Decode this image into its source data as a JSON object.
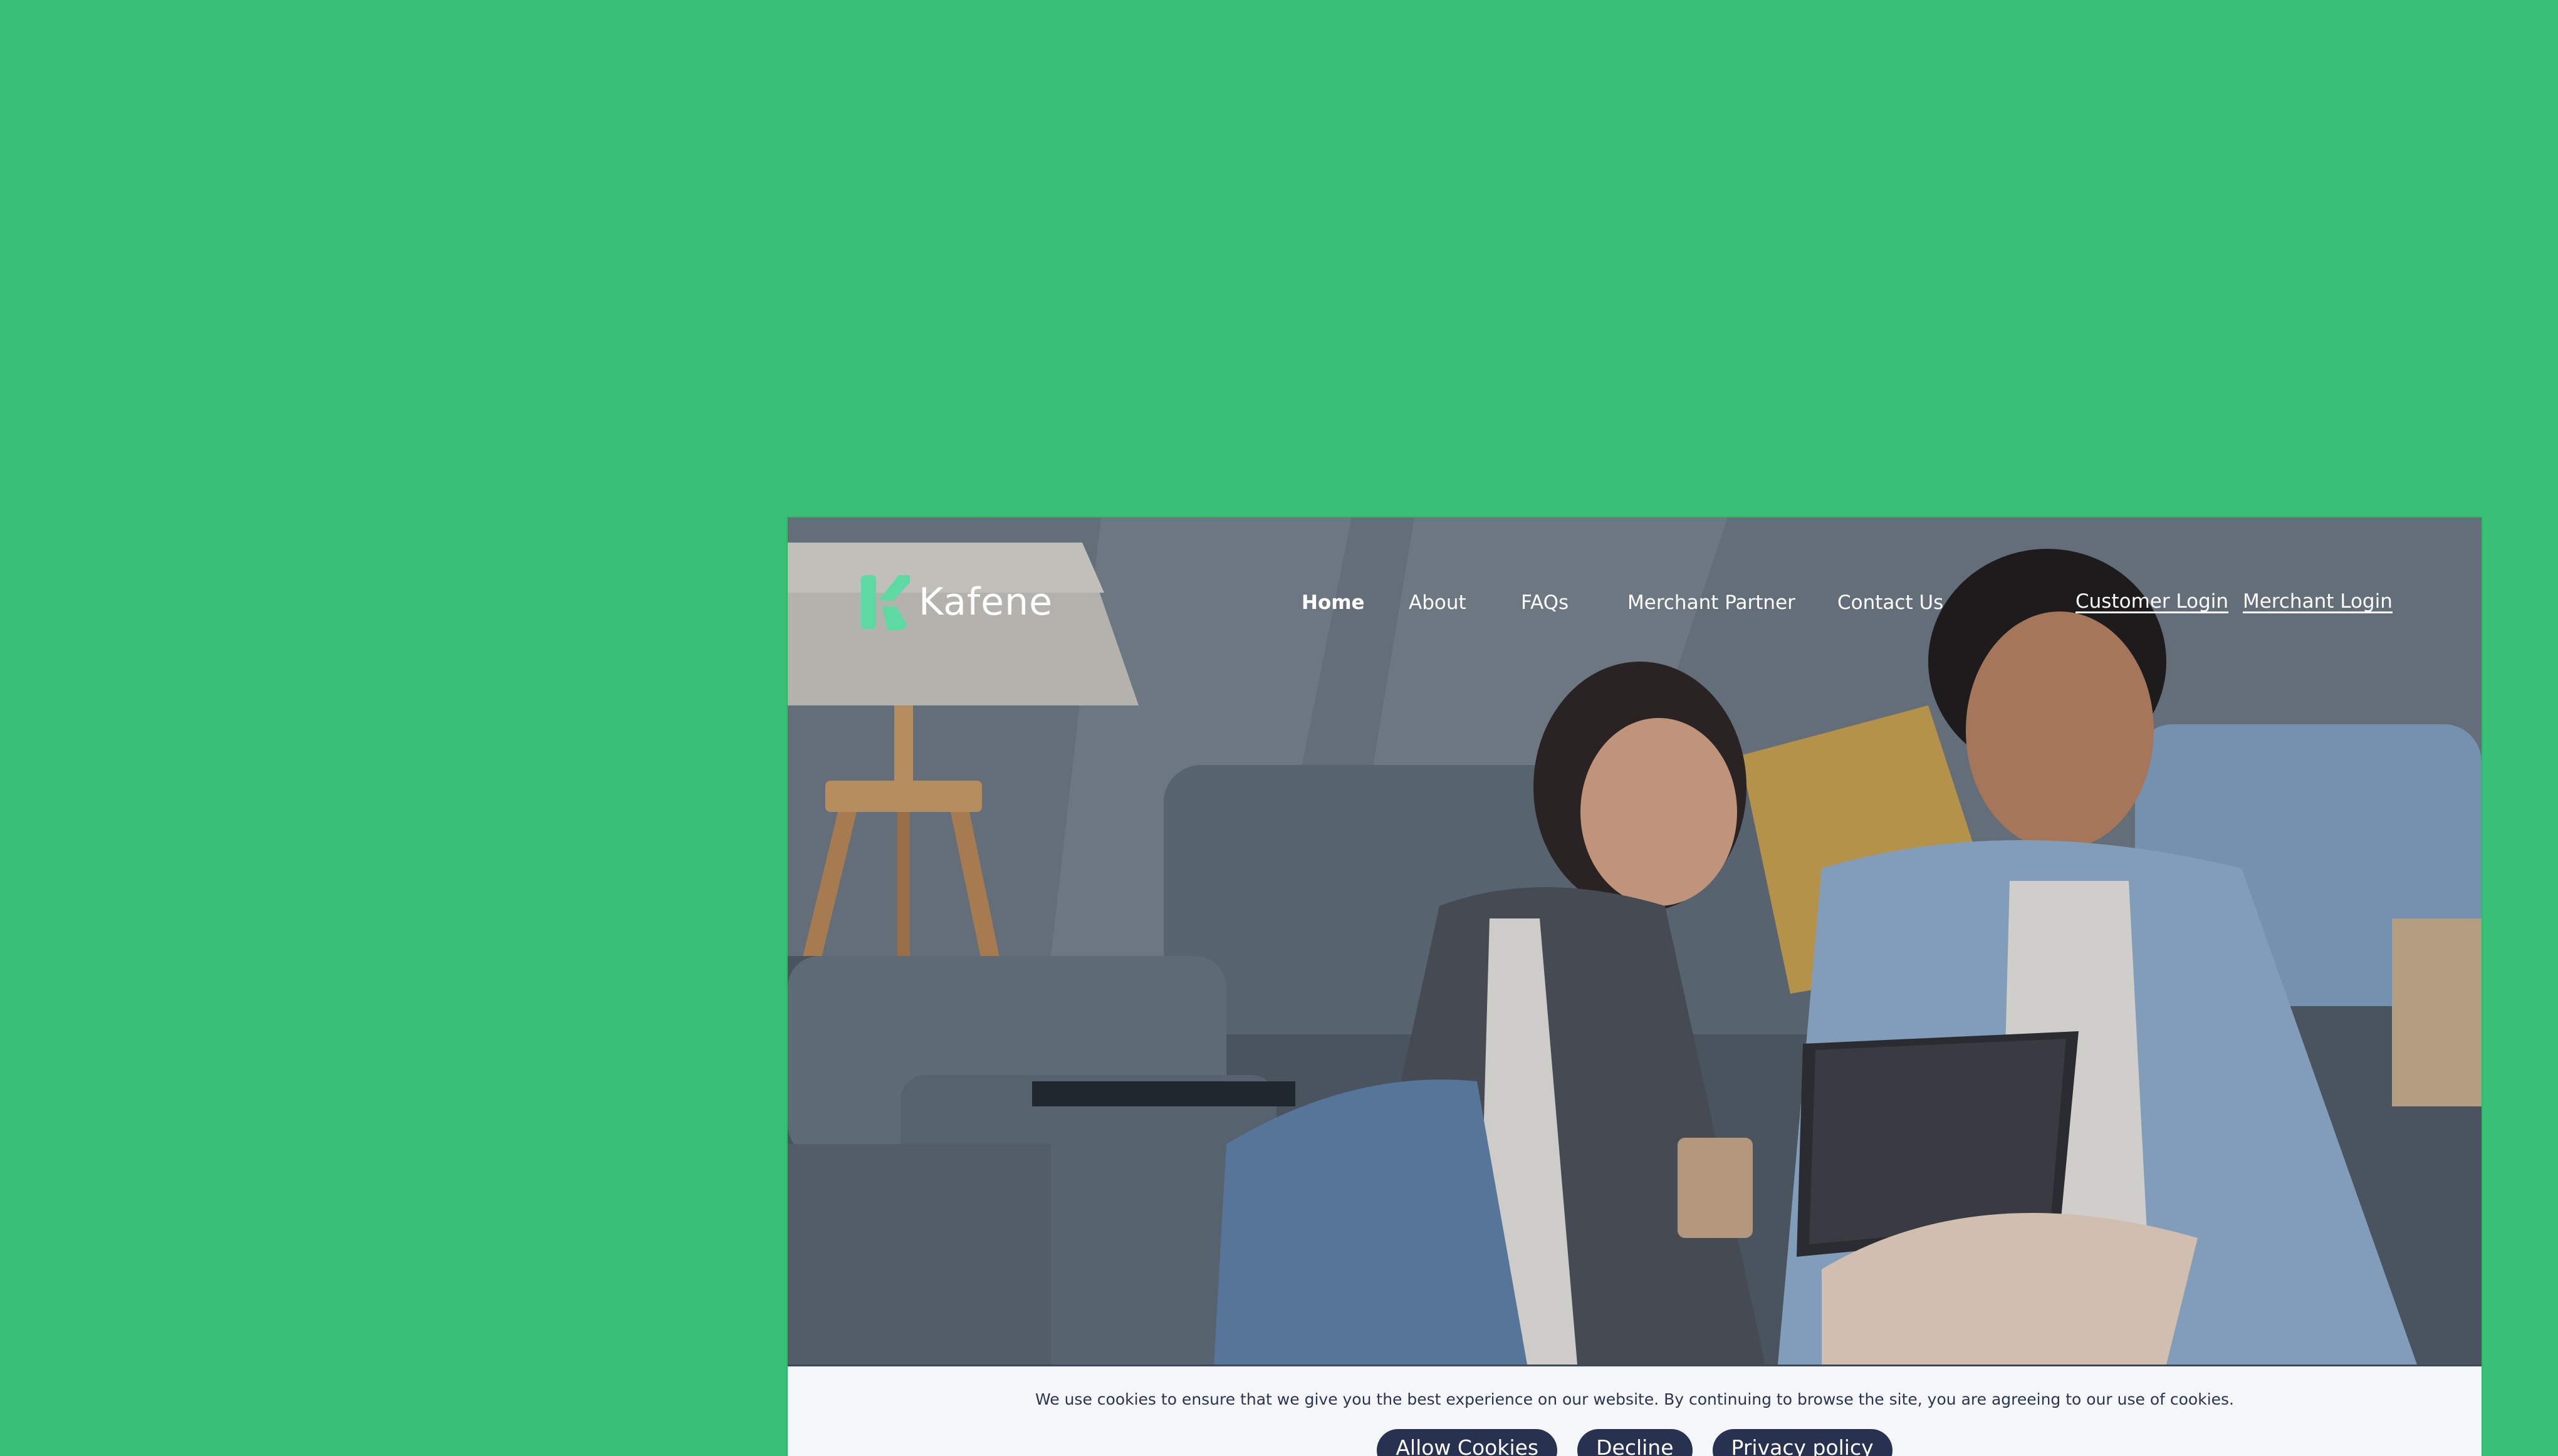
{
  "brand": {
    "name": "Kafene",
    "accent": "#5fd9a3"
  },
  "background_color": "#39c077",
  "nav": {
    "home": "Home",
    "about": "About",
    "faqs": "FAQs",
    "merchant_partner": "Merchant Partner",
    "contact": "Contact Us",
    "active": "Home"
  },
  "logins": {
    "customer": "Customer Login",
    "merchant": "Merchant Login"
  },
  "hero": {
    "image_icon": "photo-of-couple-with-tablet"
  },
  "cookie": {
    "text": "We use cookies to ensure that we give you the best experience on our website. By continuing to browse the site, you are agreeing to our use of cookies.",
    "allow": "Allow Cookies",
    "decline": "Decline",
    "privacy": "Privacy policy",
    "button_color": "#26324f"
  }
}
